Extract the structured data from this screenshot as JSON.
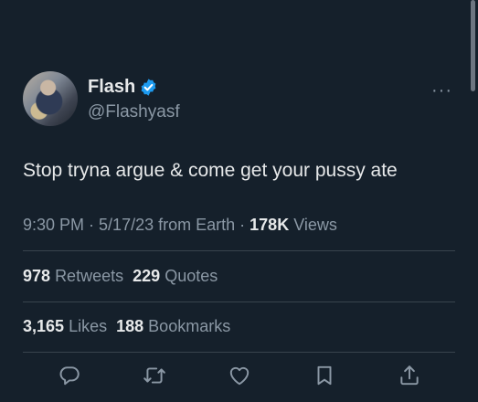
{
  "author": {
    "name": "Flash",
    "handle": "@Flashyasf",
    "verified_color": "#1d9bf0"
  },
  "tweet": {
    "text": "Stop tryna argue & come get your pussy ate"
  },
  "meta": {
    "time": "9:30 PM",
    "date": "5/17/23",
    "source": "from Earth",
    "sep": " · ",
    "views_count": "178K",
    "views_label": "Views"
  },
  "stats": {
    "retweets_count": "978",
    "retweets_label": "Retweets",
    "quotes_count": "229",
    "quotes_label": "Quotes",
    "likes_count": "3,165",
    "likes_label": "Likes",
    "bookmarks_count": "188",
    "bookmarks_label": "Bookmarks"
  },
  "more_label": "···",
  "actions": {
    "icons": [
      "reply-icon",
      "retweet-icon",
      "like-icon",
      "bookmark-icon",
      "share-icon"
    ]
  },
  "colors": {
    "background": "#15202b",
    "text": "#e7e9ea",
    "secondary": "#8b98a5",
    "divider": "#38444d"
  }
}
